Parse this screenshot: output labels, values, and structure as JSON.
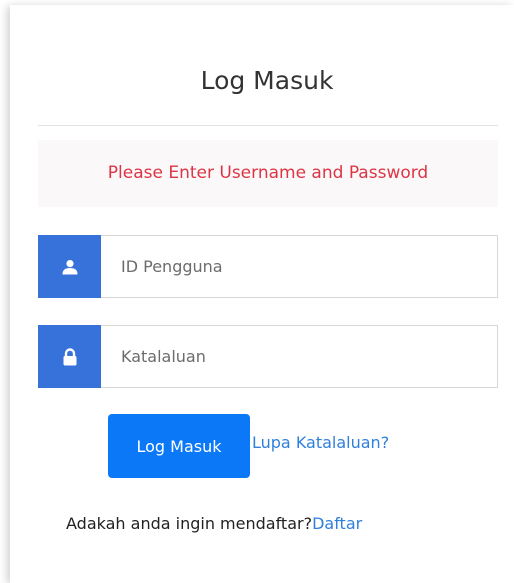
{
  "login": {
    "title": "Log Masuk",
    "alert": "Please Enter Username and Password",
    "username_placeholder": "ID Pengguna",
    "password_placeholder": "Katalaluan",
    "submit_label": "Log Masuk",
    "forgot_label": "Lupa Katalaluan?",
    "register_prompt": "Adakah anda ingin mendaftar?",
    "register_link": "Daftar"
  },
  "icons": {
    "username": "user-icon",
    "password": "lock-icon"
  },
  "colors": {
    "accent": "#3672d9",
    "button": "#0a78f7",
    "link": "#2f7fdc",
    "alert_text": "#dc3545",
    "alert_bg": "#fbf8f9"
  }
}
